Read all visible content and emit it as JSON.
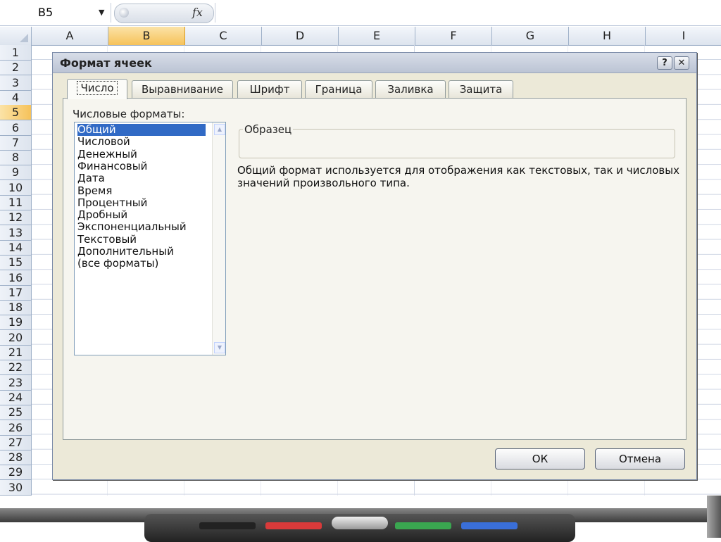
{
  "formula_bar": {
    "name_box": "B5",
    "fx_label": "fx",
    "dropdown_arrow": "▼",
    "formula_value": ""
  },
  "columns": [
    "A",
    "B",
    "C",
    "D",
    "E",
    "F",
    "G",
    "H",
    "I"
  ],
  "selected_column": "B",
  "rows": [
    "1",
    "2",
    "3",
    "4",
    "5",
    "6",
    "7",
    "8",
    "9",
    "10",
    "11",
    "12",
    "13",
    "14",
    "15",
    "16",
    "17",
    "18",
    "19",
    "20",
    "21",
    "22",
    "23",
    "24",
    "25",
    "26",
    "27",
    "28",
    "29",
    "30"
  ],
  "selected_row": "5",
  "dialog": {
    "title": "Формат ячеек",
    "help_label": "?",
    "close_label": "✕",
    "tabs": [
      {
        "label": "Число",
        "active": true
      },
      {
        "label": "Выравнивание",
        "active": false
      },
      {
        "label": "Шрифт",
        "active": false
      },
      {
        "label": "Граница",
        "active": false
      },
      {
        "label": "Заливка",
        "active": false
      },
      {
        "label": "Защита",
        "active": false
      }
    ],
    "formats_label": "Числовые форматы:",
    "formats": [
      "Общий",
      "Числовой",
      "Денежный",
      "Финансовый",
      "Дата",
      "Время",
      "Процентный",
      "Дробный",
      "Экспоненциальный",
      "Текстовый",
      "Дополнительный",
      "(все форматы)"
    ],
    "selected_format": "Общий",
    "sample_label": "Образец",
    "sample_value": "",
    "description": "Общий формат используется для отображения как текстовых, так и числовых значений произвольного типа.",
    "ok_label": "ОК",
    "cancel_label": "Отмена"
  },
  "colors": {
    "accent": "#316ac5",
    "selection_header": "#f6c25a",
    "pen_black": "#222222",
    "pen_red": "#d93a3a",
    "pen_green": "#3aa650",
    "pen_blue": "#3a6fd9"
  }
}
